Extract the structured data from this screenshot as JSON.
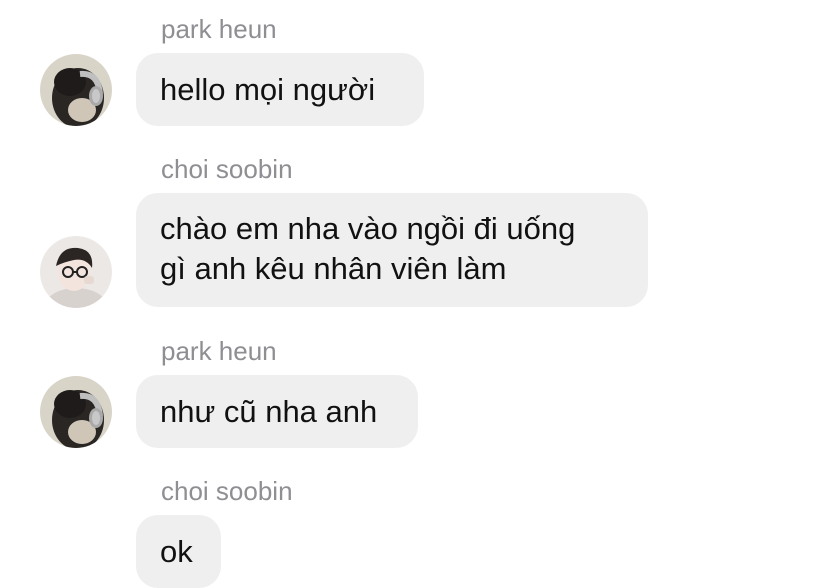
{
  "messages": [
    {
      "sender": "park heun",
      "text": "hello mọi người",
      "avatar": "headphones-girl-avatar"
    },
    {
      "sender": "choi soobin",
      "text_lines": [
        "chào em nha vào ngồi đi uống",
        "gì anh kêu nhân viên làm"
      ],
      "avatar": "glasses-boy-avatar"
    },
    {
      "sender": "park heun",
      "text": "như cũ nha anh",
      "avatar": "headphones-girl-avatar"
    },
    {
      "sender": "choi soobin",
      "text": "ok"
    }
  ],
  "colors": {
    "bubble": "#efeff0",
    "sender_name": "#8e8e93",
    "message_text": "#111111"
  }
}
